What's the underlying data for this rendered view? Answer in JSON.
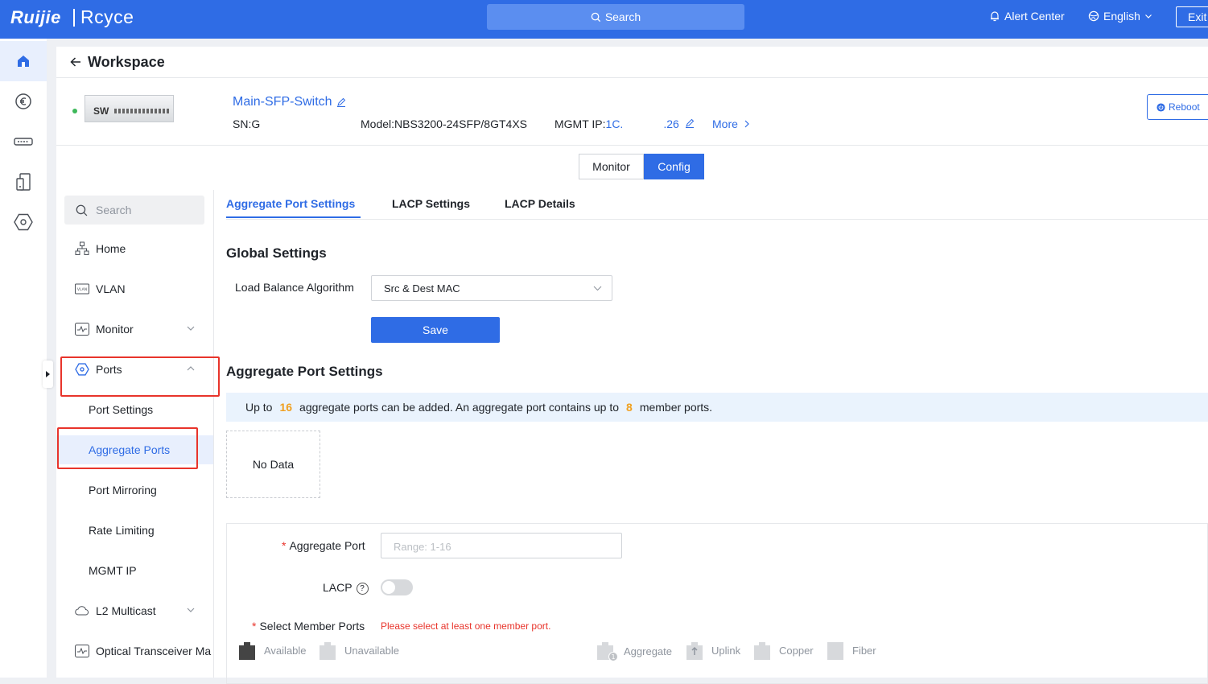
{
  "topbar": {
    "brand": "Ruijie",
    "product": "Rcyce",
    "search_label": "Search",
    "alert_label": "Alert Center",
    "language": "English",
    "exit_label": "Exit"
  },
  "workspace": {
    "title": "Workspace"
  },
  "device": {
    "image_label": "SW",
    "name": "Main-SFP-Switch",
    "sn_prefix": "SN:G",
    "model": "Model:NBS3200-24SFP/8GT4XS",
    "mgmt_label": "MGMT IP:",
    "mgmt_ip_start": "1C.",
    "mgmt_ip_end": ".26",
    "more_label": "More",
    "reboot_label": "Reboot",
    "status_color": "#3db85a"
  },
  "mode_tabs": {
    "monitor": "Monitor",
    "config": "Config",
    "active": "Config"
  },
  "sidebar": {
    "search_placeholder": "Search",
    "items": [
      {
        "label": "Home",
        "icon": "topology-icon"
      },
      {
        "label": "VLAN",
        "icon": "vlan-icon"
      },
      {
        "label": "Monitor",
        "icon": "monitor-icon",
        "expandable": true
      },
      {
        "label": "Ports",
        "icon": "port-icon",
        "expanded": true
      },
      {
        "label": "L2 Multicast",
        "icon": "cloud-icon",
        "expandable": true
      },
      {
        "label": "Optical Transceiver Ma",
        "icon": "monitor-icon"
      }
    ],
    "sub_items": [
      {
        "label": "Port Settings"
      },
      {
        "label": "Aggregate Ports",
        "active": true
      },
      {
        "label": "Port Mirroring"
      },
      {
        "label": "Rate Limiting"
      },
      {
        "label": "MGMT IP"
      }
    ]
  },
  "content": {
    "tabs": [
      "Aggregate Port Settings",
      "LACP Settings",
      "LACP Details"
    ],
    "active_tab": "Aggregate Port Settings",
    "global_title": "Global Settings",
    "lba_label": "Load Balance Algorithm",
    "lba_value": "Src & Dest MAC",
    "save_label": "Save",
    "agg_title": "Aggregate Port Settings",
    "info": {
      "pre": "Up to",
      "max_ports": "16",
      "mid": "aggregate ports can be added. An aggregate port contains up to",
      "max_members": "8",
      "post": "member ports."
    },
    "no_data": "No Data",
    "form": {
      "agg_port_label": "Aggregate Port",
      "agg_port_placeholder": "Range: 1-16",
      "lacp_label": "LACP",
      "lacp_help": "?",
      "lacp_enabled": false,
      "member_label": "Select Member Ports",
      "member_error": "Please select at least one member port.",
      "legend": {
        "available": "Available",
        "unavailable": "Unavailable",
        "aggregate": "Aggregate",
        "aggregate_badge": "1",
        "uplink": "Uplink",
        "copper": "Copper",
        "fiber": "Fiber"
      }
    }
  },
  "colors": {
    "primary": "#2f6ce5",
    "highlight_box": "#e8342b",
    "warning_number": "#f0a020"
  }
}
